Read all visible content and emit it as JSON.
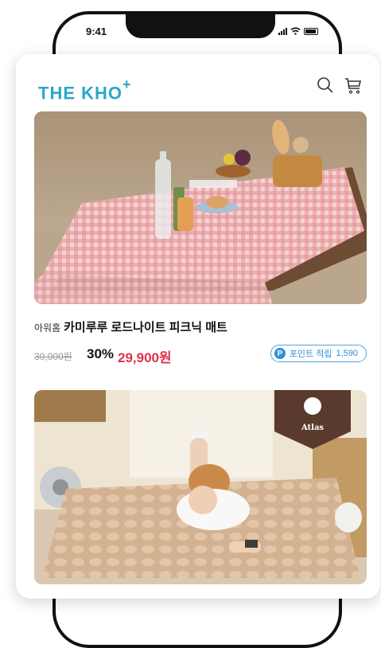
{
  "status_bar": {
    "time": "9:41"
  },
  "header": {
    "logo_text": "THE KHO",
    "logo_plus": "+"
  },
  "icons": {
    "search": "search-icon",
    "cart": "cart-icon"
  },
  "products": [
    {
      "brand": "아워홈",
      "name": "카미루루 로드나이트 피크닉 매트",
      "original_price": "30,000원",
      "discount": "30%",
      "sale_price": "29,900원",
      "points_label": "포인트 적립",
      "points_value": "1,590",
      "image": "picnic-table-photo"
    },
    {
      "badge": "Atlas",
      "image": "air-mattress-photo"
    }
  ],
  "colors": {
    "brand": "#2aa8c9",
    "sale": "#e0314b",
    "points": "#2f8fd8"
  }
}
